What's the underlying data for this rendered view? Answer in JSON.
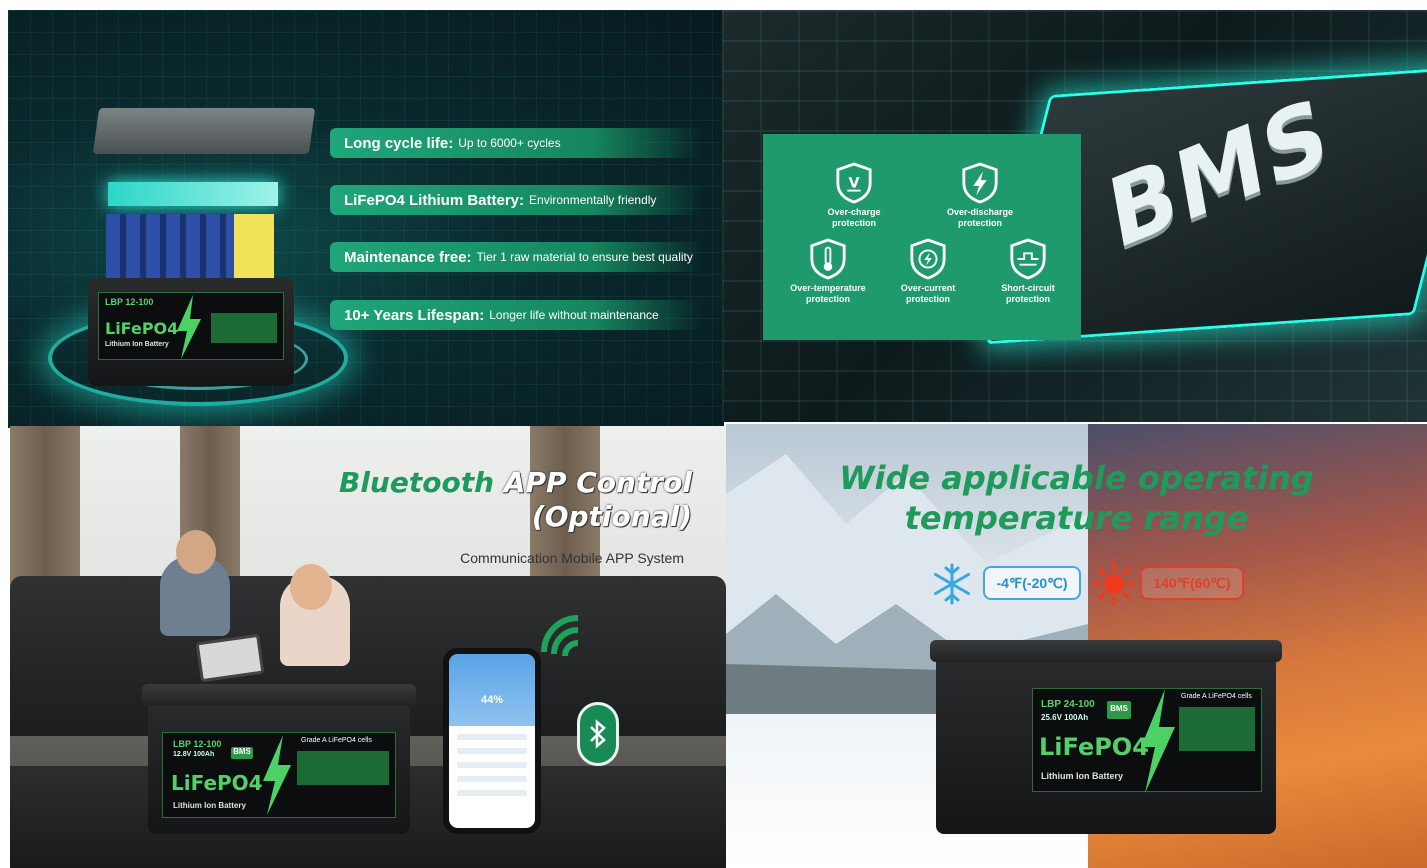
{
  "panel_features": {
    "items": [
      {
        "title": "Long cycle life:",
        "desc": "Up to 6000+ cycles"
      },
      {
        "title": "LiFePO4 Lithium Battery:",
        "desc": "Environmentally friendly"
      },
      {
        "title": "Maintenance free:",
        "desc": "Tier 1 raw material to ensure best quality"
      },
      {
        "title": "10+ Years Lifespan:",
        "desc": "Longer life without maintenance"
      }
    ],
    "battery": {
      "model": "LBP 12-100",
      "chem": "LiFePO4",
      "sub": "Lithium Ion Battery"
    }
  },
  "panel_bms": {
    "chip_text": "BMS",
    "protections": [
      {
        "line1": "Over-charge",
        "line2": "protection",
        "icon": "voltage-shield-icon"
      },
      {
        "line1": "Over-discharge",
        "line2": "protection",
        "icon": "bolt-shield-icon"
      },
      {
        "line1": "Over-temperature",
        "line2": "protection",
        "icon": "thermometer-shield-icon"
      },
      {
        "line1": "Over-current",
        "line2": "protection",
        "icon": "current-shield-icon"
      },
      {
        "line1": "Short-circuit",
        "line2": "protection",
        "icon": "circuit-shield-icon"
      }
    ]
  },
  "panel_bluetooth": {
    "title_green": "Bluetooth",
    "title_white": "APP Control",
    "title_line2": "(Optional)",
    "subtitle": "Communication Mobile APP System",
    "app_percent": "44%",
    "battery": {
      "model": "LBP 12-100",
      "spec": "12.8V 100Ah",
      "bms": "BMS",
      "grade": "Grade A LiFePO4 cells",
      "chem": "LiFePO4",
      "sub": "Lithium Ion Battery"
    }
  },
  "panel_temperature": {
    "title_line1": "Wide applicable operating",
    "title_line2": "temperature range",
    "cold": "-4℉(-20℃)",
    "hot": "140℉(60℃)",
    "battery": {
      "model": "LBP 24-100",
      "spec": "25.6V 100Ah",
      "bms": "BMS",
      "grade": "Grade A LiFePO4 cells",
      "chem": "LiFePO4",
      "sub": "Lithium Ion Battery"
    }
  },
  "colors": {
    "accent_green": "#1e9a6c",
    "title_green": "#1f9a5a",
    "cold_blue": "#2590d0",
    "hot_red": "#e0402a"
  }
}
